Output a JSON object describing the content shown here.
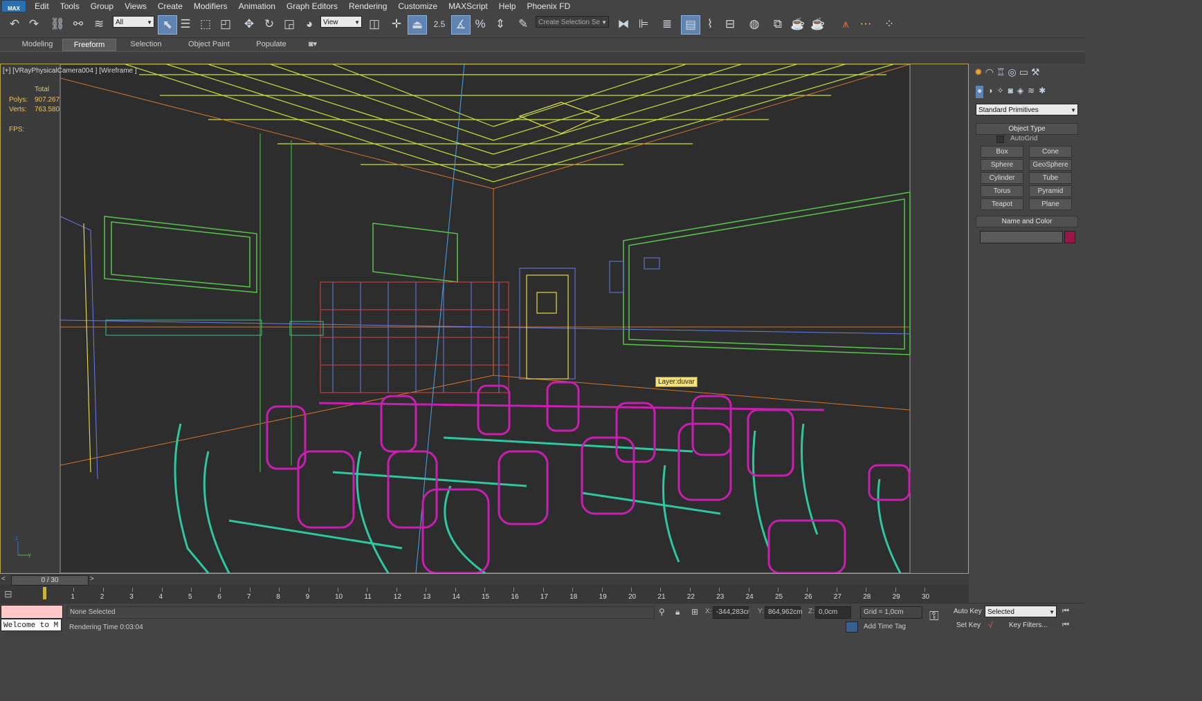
{
  "menu": {
    "logo": "MAX",
    "items": [
      "Edit",
      "Tools",
      "Group",
      "Views",
      "Create",
      "Modifiers",
      "Animation",
      "Graph Editors",
      "Rendering",
      "Customize",
      "MAXScript",
      "Help",
      "Phoenix FD"
    ]
  },
  "toolbar": {
    "selection_filter": "All",
    "ref_coord": "View",
    "snap_value": "2.5",
    "named_selection_placeholder": "Create Selection Se"
  },
  "ribbon": {
    "tabs": [
      "Modeling",
      "Freeform",
      "Selection",
      "Object Paint",
      "Populate"
    ],
    "selected": "Freeform"
  },
  "viewport": {
    "label": "[+] [VRayPhysicalCamera004 ] [Wireframe ]",
    "stats": {
      "total_label": "Total",
      "polys_label": "Polys:",
      "polys_value": "907.267",
      "verts_label": "Verts:",
      "verts_value": "763.580",
      "fps_label": "FPS:"
    },
    "tooltip": "Layer:duvar"
  },
  "command_panel": {
    "category": "Standard Primitives",
    "object_type_title": "Object Type",
    "autogrid": "AutoGrid",
    "buttons": [
      "Box",
      "Cone",
      "Sphere",
      "GeoSphere",
      "Cylinder",
      "Tube",
      "Torus",
      "Pyramid",
      "Teapot",
      "Plane"
    ],
    "name_color_title": "Name and Color",
    "object_color": "#9b1446"
  },
  "timeline": {
    "frame": "0 / 30",
    "ticks": [
      "1",
      "2",
      "3",
      "4",
      "5",
      "6",
      "7",
      "8",
      "9",
      "10",
      "11",
      "12",
      "13",
      "14",
      "15",
      "16",
      "17",
      "18",
      "19",
      "20",
      "21",
      "22",
      "23",
      "24",
      "25",
      "26",
      "27",
      "28",
      "29",
      "30"
    ]
  },
  "status": {
    "script_listener": "Welcome to M",
    "selection_info": "None Selected",
    "rendering_time": "Rendering Time  0:03:04",
    "x_label": "X:",
    "x_value": "-344,283cr",
    "y_label": "Y:",
    "y_value": "864,962cm",
    "z_label": "Z:",
    "z_value": "0,0cm",
    "grid": "Grid = 1,0cm",
    "add_time_tag": "Add Time Tag",
    "auto_key": "Auto Key",
    "set_key": "Set Key",
    "key_mode": "Selected",
    "key_filters": "Key Filters..."
  }
}
